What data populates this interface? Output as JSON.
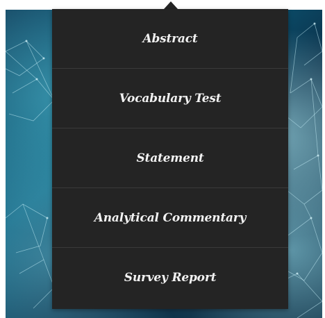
{
  "menu": {
    "items": [
      {
        "label": "Abstract"
      },
      {
        "label": "Vocabulary Test"
      },
      {
        "label": "Statement"
      },
      {
        "label": "Analytical Commentary"
      },
      {
        "label": "Survey Report"
      }
    ]
  },
  "colors": {
    "menu_background": "#242424",
    "menu_divider": "#3a3a3a",
    "menu_text": "#f2f2f2",
    "backdrop_dark": "#0e3a57",
    "backdrop_accent": "#5ac8dc"
  }
}
